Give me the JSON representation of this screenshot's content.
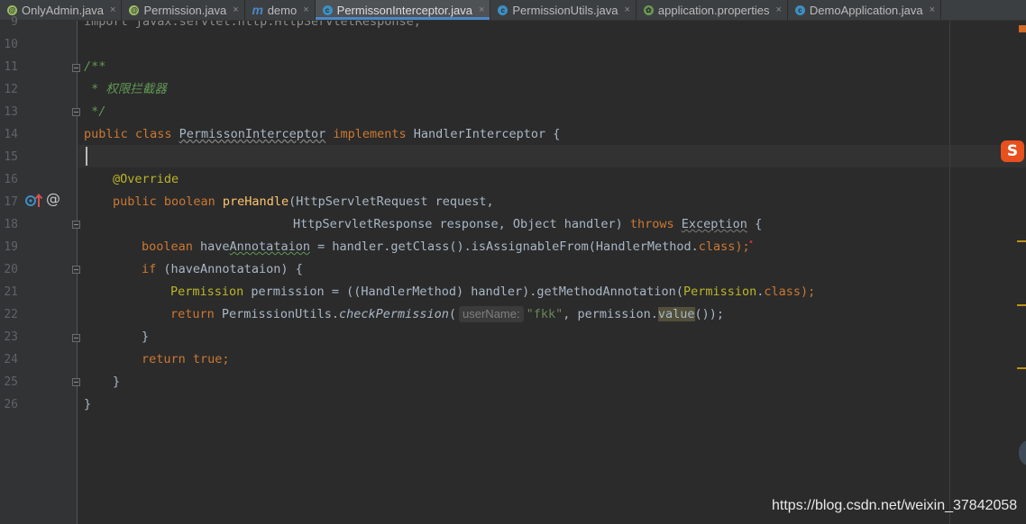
{
  "tabs": [
    {
      "icon": "annotation-icon",
      "label": "OnlyAdmin.java",
      "close": "×"
    },
    {
      "icon": "annotation-icon",
      "label": "Permission.java",
      "close": "×"
    },
    {
      "icon": "module-icon",
      "label": "demo",
      "close": "×"
    },
    {
      "icon": "class-icon",
      "label": "PermissonInterceptor.java",
      "close": "×",
      "active": true
    },
    {
      "icon": "class-icon",
      "label": "PermissionUtils.java",
      "close": "×"
    },
    {
      "icon": "spring-properties-icon",
      "label": "application.properties",
      "close": "×"
    },
    {
      "icon": "spring-class-icon",
      "label": "DemoApplication.java",
      "close": "×"
    }
  ],
  "line_numbers": [
    "9",
    "10",
    "11",
    "12",
    "13",
    "14",
    "15",
    "16",
    "17",
    "18",
    "19",
    "20",
    "21",
    "22",
    "23",
    "24",
    "25",
    "26"
  ],
  "code": {
    "l9": "import javax.servlet.http.HttpServletResponse;",
    "l11": "/**",
    "l12": " * 权限拦截器",
    "l13": " */",
    "l14": {
      "kw1": "public class ",
      "cls": "PermissonInterceptor",
      "kw2": " implements ",
      "rest": "HandlerInterceptor {"
    },
    "l16": "@Override",
    "l17": {
      "kw": "public boolean ",
      "fn": "preHandle",
      "rest": "(HttpServletRequest request,"
    },
    "l18": {
      "rest": "HttpServletResponse response, Object handler) ",
      "kw": "throws ",
      "exc": "Exception",
      "end": " {"
    },
    "l19": {
      "kw": "boolean ",
      "var1": "have",
      "var2": "Annotataion",
      "mid": " = handler.getClass().isAssignableFrom(HandlerMethod.",
      "kw2": "class",
      "end": ");"
    },
    "l20": {
      "kw": "if ",
      "rest": "(haveAnnotataion) {"
    },
    "l21": {
      "ann": "Permission",
      "mid": " permission = ((HandlerMethod) handler).getMethodAnnotation(",
      "ann2": "Permission",
      "dot": ".",
      "kw": "class",
      "end": ");"
    },
    "l22": {
      "kw": "return ",
      "cls": "PermissionUtils.",
      "fn": "checkPermission",
      "open": "(",
      "hint": "userName:",
      "str": "\"fkk\"",
      "mid": ", permission.",
      "val": "value",
      "end": "());"
    },
    "l23": "}",
    "l24": {
      "kw": "return true",
      "end": ";"
    },
    "l25": "}",
    "l26": "}"
  },
  "watermark": "https://blog.csdn.net/weixin_37842058",
  "sogou_label": "S",
  "colors": {
    "keyword": "#cc7832",
    "comment": "#629755",
    "annotation": "#bbb529",
    "function": "#ffc66d",
    "string": "#6a8759",
    "text": "#a9b7c6"
  }
}
